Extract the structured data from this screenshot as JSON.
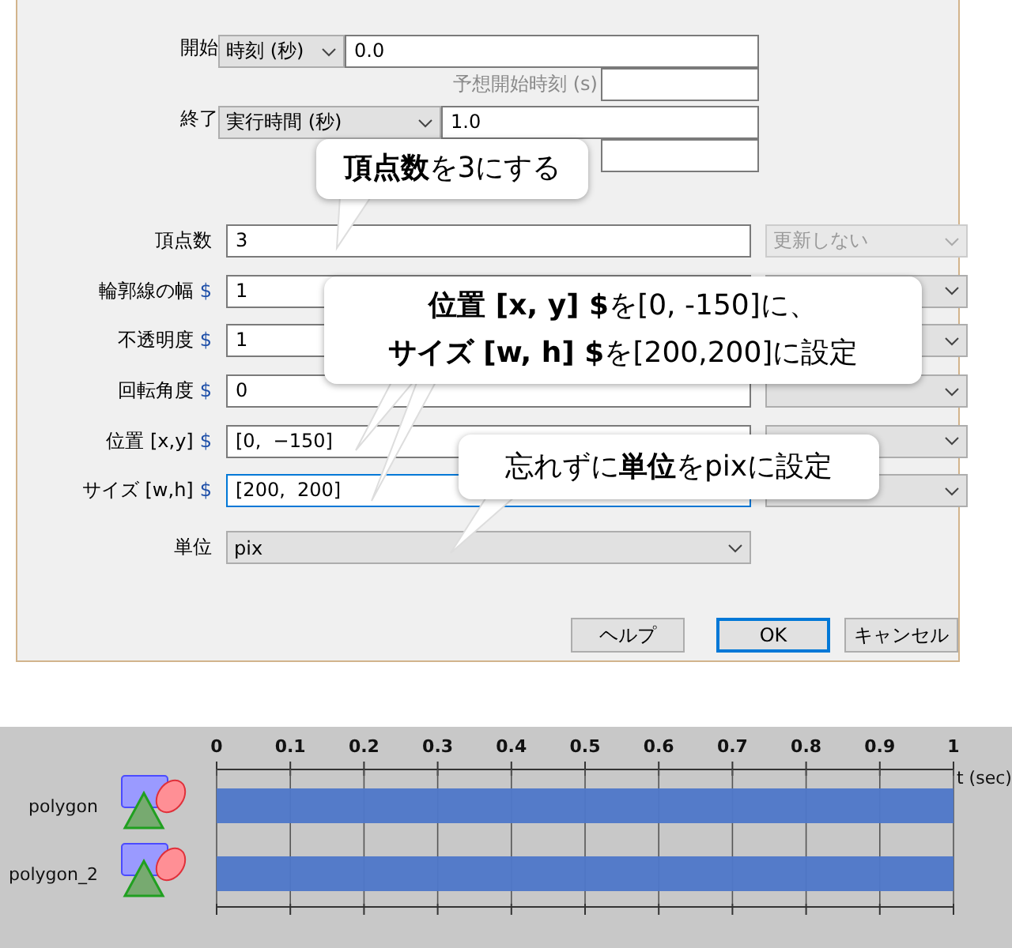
{
  "start": {
    "label": "開始",
    "mode": "時刻 (秒)",
    "value": "0.0",
    "estimate_label": "予想開始時刻 (s)",
    "estimate_disabled": true
  },
  "end": {
    "label": "終了",
    "mode": "実行時間 (秒)",
    "value": "1.0"
  },
  "fields": [
    {
      "label": "頂点数",
      "value": "3",
      "focused": false,
      "update": {
        "text": "更新しない",
        "disabled": true
      }
    },
    {
      "label": "輪郭線の幅",
      "suffix": "$",
      "value": "1",
      "focused": false,
      "update": {
        "disabled": false
      }
    },
    {
      "label": "不透明度",
      "suffix": "$",
      "value": "1",
      "focused": false,
      "update": {
        "disabled": false
      }
    },
    {
      "label": "回転角度",
      "suffix": "$",
      "value": "0",
      "focused": false,
      "update": {
        "disabled": false
      }
    },
    {
      "label": "位置 [x,y]",
      "suffix": "$",
      "value": "[0,  −150]",
      "focused": false,
      "update": {
        "disabled": false
      }
    },
    {
      "label": "サイズ [w,h]",
      "suffix": "$",
      "value": "[200,  200]",
      "focused": true,
      "update": {
        "disabled": false
      }
    }
  ],
  "unit": {
    "label": "単位",
    "value": "pix"
  },
  "buttons": [
    {
      "label": "ヘルプ",
      "default": false
    },
    {
      "label": "OK",
      "default": true
    },
    {
      "label": "キャンセル",
      "default": false
    }
  ],
  "callouts": [
    {
      "lines": [
        "**頂点数**を3にする"
      ]
    },
    {
      "lines": [
        "**位置 [x, y] $**を[0, -150]に、",
        "**サイズ [w, h] $**を[200,200]に設定"
      ]
    },
    {
      "lines": [
        "忘れずに**単位**をpixに設定"
      ]
    }
  ],
  "timeline": {
    "chart_data": {
      "type": "bar",
      "orientation": "horizontal",
      "xlabel": "t (sec)",
      "categories": [
        "polygon",
        "polygon_2"
      ],
      "values": [
        1,
        1
      ],
      "xlim": [
        0,
        1
      ],
      "grid": true,
      "xticks": [
        0,
        0.1,
        0.2,
        0.3,
        0.4,
        0.5,
        0.6,
        0.7,
        0.8,
        0.9,
        1
      ]
    }
  }
}
